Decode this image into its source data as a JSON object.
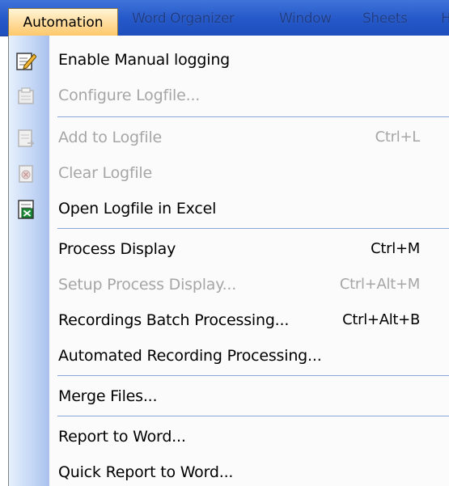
{
  "menubar": {
    "items": [
      {
        "label": "Automation"
      },
      {
        "label": "Word Organizer"
      },
      {
        "label": "Window"
      },
      {
        "label": "Sheets"
      },
      {
        "label": "H"
      }
    ]
  },
  "menu": {
    "items": [
      {
        "label": "Enable Manual logging",
        "shortcut": "",
        "icon": "notepad-pencil-icon"
      },
      {
        "label": "Configure Logfile...",
        "shortcut": "",
        "icon": "configure-logfile-icon"
      },
      {
        "label": "Add to Logfile",
        "shortcut": "Ctrl+L",
        "icon": "add-log-icon"
      },
      {
        "label": "Clear Logfile",
        "shortcut": "",
        "icon": "clear-log-icon"
      },
      {
        "label": "Open Logfile in Excel",
        "shortcut": "",
        "icon": "excel-icon"
      },
      {
        "label": "Process Display",
        "shortcut": "Ctrl+M",
        "icon": ""
      },
      {
        "label": "Setup Process Display...",
        "shortcut": "Ctrl+Alt+M",
        "icon": ""
      },
      {
        "label": "Recordings Batch Processing...",
        "shortcut": "Ctrl+Alt+B",
        "icon": ""
      },
      {
        "label": "Automated Recording Processing...",
        "shortcut": "",
        "icon": ""
      },
      {
        "label": "Merge Files...",
        "shortcut": "",
        "icon": ""
      },
      {
        "label": "Report to Word...",
        "shortcut": "",
        "icon": ""
      },
      {
        "label": "Quick Report to Word...",
        "shortcut": "",
        "icon": ""
      }
    ]
  }
}
